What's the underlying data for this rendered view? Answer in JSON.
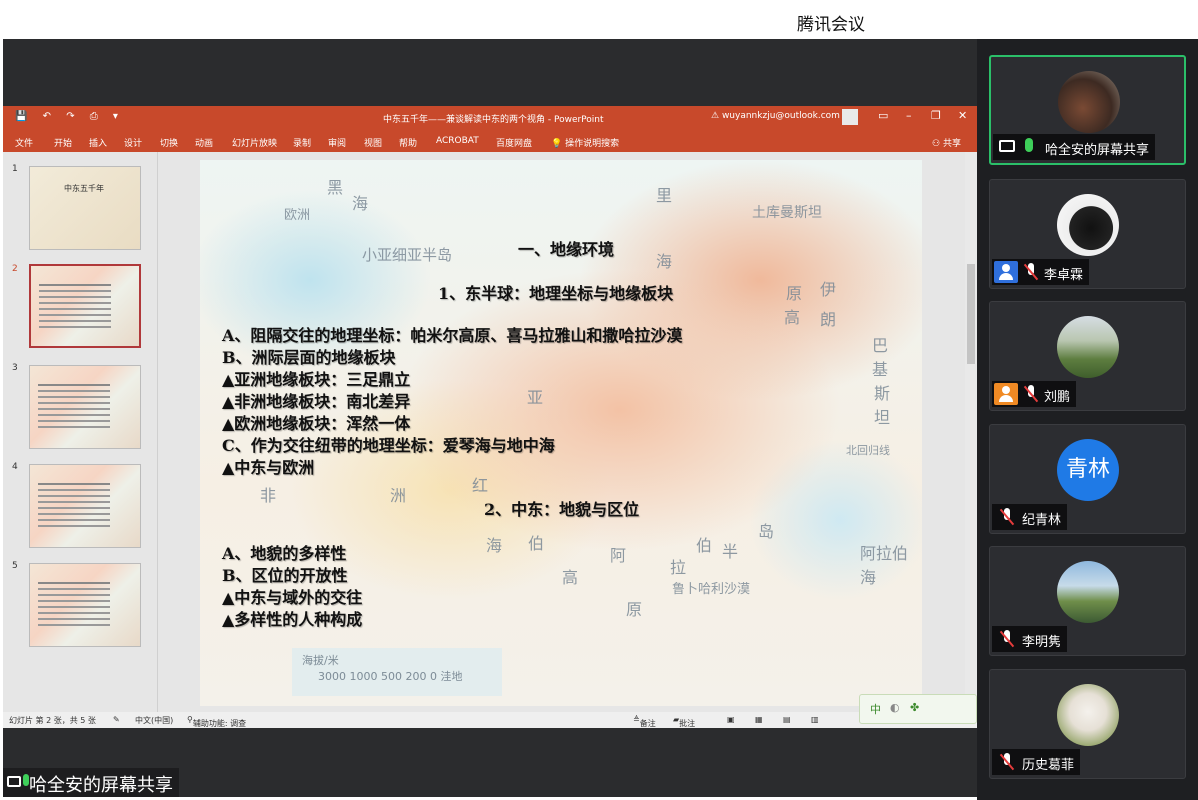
{
  "app": {
    "title": "腾讯会议"
  },
  "ppt": {
    "doc_title": "中东五千年——兼谈解读中东的两个视角  -  PowerPoint",
    "account": "wuyannkzju@outlook.com",
    "ribbon_tabs": [
      "文件",
      "开始",
      "插入",
      "设计",
      "切换",
      "动画",
      "幻灯片放映",
      "录制",
      "审阅",
      "视图",
      "帮助",
      "ACROBAT",
      "百度网盘",
      "操作说明搜索",
      "共享"
    ],
    "thumb_numbers": [
      "1",
      "2",
      "3",
      "4",
      "5"
    ],
    "thumb1_title": "中东五千年",
    "slide": {
      "heading": "一、地缘环境",
      "sub1": "1、东半球：地理坐标与地缘板块",
      "lines1": [
        "A、阻隔交往的地理坐标：帕米尔高原、喜马拉雅山和撒哈拉沙漠",
        "B、洲际层面的地缘板块",
        "▲亚洲地缘板块：三足鼎立",
        "▲非洲地缘板块：南北差异",
        "▲欧洲地缘板块：浑然一体",
        "C、作为交往纽带的地理坐标：爱琴海与地中海",
        "▲中东与欧洲"
      ],
      "sub2": "2、中东：地貌与区位",
      "lines2": [
        "A、地貌的多样性",
        "B、区位的开放性",
        "▲中东与域外的交往",
        "▲多样性的人种构成"
      ],
      "map_labels": [
        "黑",
        "海",
        "里",
        "海",
        "土库曼斯坦",
        "欧洲",
        "小亚细亚半岛",
        "亚",
        "非",
        "洲",
        "红",
        "海",
        "伯",
        "阿",
        "拉",
        "伯",
        "半",
        "岛",
        "高",
        "原",
        "鲁卜哈利沙漠",
        "伊",
        "朗",
        "高",
        "原",
        "巴",
        "基",
        "斯",
        "坦",
        "北回归线",
        "阿拉伯海",
        "海拔/米"
      ],
      "legend_values": "3000  1000  500  200    0  洼地",
      "legend_title": "海拔/米"
    },
    "status": {
      "slide_info": "幻灯片 第 2 张，共 5 张",
      "lang": "中文(中国)",
      "accessibility": "辅助功能: 调查",
      "notes": "备注",
      "comments": "批注"
    },
    "ime": {
      "mode": "中"
    }
  },
  "share_tag": "哈全安的屏幕共享",
  "participants": [
    {
      "name": "哈全安的屏幕共享",
      "active": true,
      "avatar": "photo-room"
    },
    {
      "name": "李卓霖",
      "avatar": "photo-cat"
    },
    {
      "name": "刘鹏",
      "avatar": "photo-garden"
    },
    {
      "name": "纪青林",
      "avatar_text": "青林"
    },
    {
      "name": "李明隽",
      "avatar": "photo-campus"
    },
    {
      "name": "历史葛菲",
      "avatar": "photo-dog"
    }
  ],
  "colors": {
    "ppt_red": "#c8492b",
    "accent_green": "#2bbf69",
    "avatar_blue": "#1f7ae6",
    "user_badge_blue": "#2f6fdc",
    "user_badge_orange": "#f08a24"
  }
}
